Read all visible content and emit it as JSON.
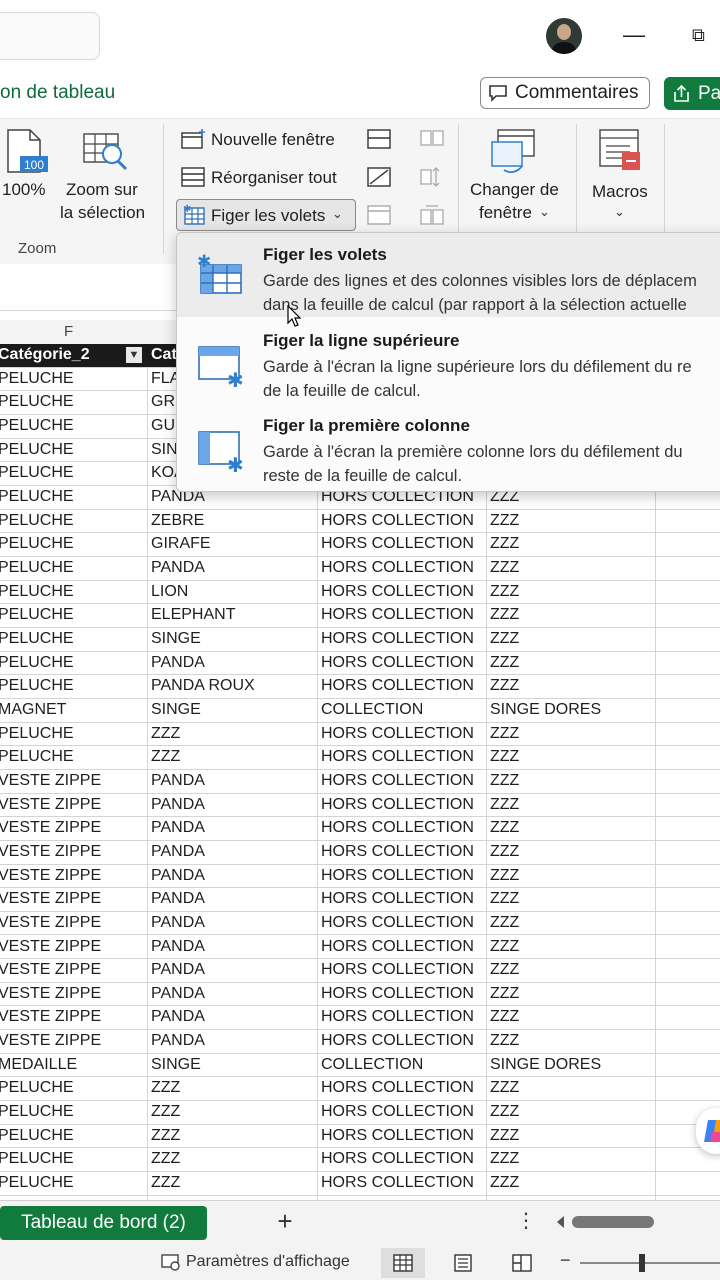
{
  "titlebar": {
    "minimize_glyph": "—",
    "restore_glyph": "⧉"
  },
  "tabbar": {
    "active_tab_partial": "on de tableau",
    "comments_label": "Commentaires",
    "share_label_partial": "Par"
  },
  "ribbon": {
    "zoom100_label": "100%",
    "zoom_selection_label_line1": "Zoom sur",
    "zoom_selection_label_line2": "la sélection",
    "zoom_group_label": "Zoom",
    "new_window_label": "Nouvelle fenêtre",
    "arrange_all_label": "Réorganiser tout",
    "freeze_panes_label": "Figer les volets",
    "switch_window_line1": "Changer de",
    "switch_window_line2": "fenêtre",
    "macros_label": "Macros",
    "zoom_icon_text": "100"
  },
  "dropdown": {
    "items": [
      {
        "title": "Figer les volets",
        "desc_line1": "Garde des lignes et des colonnes visibles lors de déplacem",
        "desc_line2": "dans la feuille de calcul (par rapport à la sélection actuelle"
      },
      {
        "title": "Figer la ligne supérieure",
        "desc_line1": "Garde à l'écran la ligne supérieure lors du défilement du re",
        "desc_line2": "de la feuille de calcul."
      },
      {
        "title": "Figer la première colonne",
        "desc_line1": "Garde à l'écran la première colonne lors du défilement du",
        "desc_line2": "reste de la feuille de calcul."
      }
    ]
  },
  "sheet": {
    "column_letter": "F",
    "header": [
      "Catégorie_2",
      "Cat"
    ],
    "rows": [
      [
        "PELUCHE",
        "FLA",
        "",
        ""
      ],
      [
        "PELUCHE",
        "GRI",
        "",
        ""
      ],
      [
        "PELUCHE",
        "GU",
        "",
        ""
      ],
      [
        "PELUCHE",
        "SIN",
        "",
        ""
      ],
      [
        "PELUCHE",
        "KOA",
        "",
        ""
      ],
      [
        "PELUCHE",
        "PANDA",
        "HORS COLLECTION",
        "ZZZ"
      ],
      [
        "PELUCHE",
        "ZEBRE",
        "HORS COLLECTION",
        "ZZZ"
      ],
      [
        "PELUCHE",
        "GIRAFE",
        "HORS COLLECTION",
        "ZZZ"
      ],
      [
        "PELUCHE",
        "PANDA",
        "HORS COLLECTION",
        "ZZZ"
      ],
      [
        "PELUCHE",
        "LION",
        "HORS COLLECTION",
        "ZZZ"
      ],
      [
        "PELUCHE",
        "ELEPHANT",
        "HORS COLLECTION",
        "ZZZ"
      ],
      [
        "PELUCHE",
        "SINGE",
        "HORS COLLECTION",
        "ZZZ"
      ],
      [
        "PELUCHE",
        "PANDA",
        "HORS COLLECTION",
        "ZZZ"
      ],
      [
        "PELUCHE",
        "PANDA ROUX",
        "HORS COLLECTION",
        "ZZZ"
      ],
      [
        "MAGNET",
        "SINGE",
        "COLLECTION",
        "SINGE DORES"
      ],
      [
        "PELUCHE",
        "ZZZ",
        "HORS COLLECTION",
        "ZZZ"
      ],
      [
        "PELUCHE",
        "ZZZ",
        "HORS COLLECTION",
        "ZZZ"
      ],
      [
        "VESTE ZIPPE",
        "PANDA",
        "HORS COLLECTION",
        "ZZZ"
      ],
      [
        "VESTE ZIPPE",
        "PANDA",
        "HORS COLLECTION",
        "ZZZ"
      ],
      [
        "VESTE ZIPPE",
        "PANDA",
        "HORS COLLECTION",
        "ZZZ"
      ],
      [
        "VESTE ZIPPE",
        "PANDA",
        "HORS COLLECTION",
        "ZZZ"
      ],
      [
        "VESTE ZIPPE",
        "PANDA",
        "HORS COLLECTION",
        "ZZZ"
      ],
      [
        "VESTE ZIPPE",
        "PANDA",
        "HORS COLLECTION",
        "ZZZ"
      ],
      [
        "VESTE ZIPPE",
        "PANDA",
        "HORS COLLECTION",
        "ZZZ"
      ],
      [
        "VESTE ZIPPE",
        "PANDA",
        "HORS COLLECTION",
        "ZZZ"
      ],
      [
        "VESTE ZIPPE",
        "PANDA",
        "HORS COLLECTION",
        "ZZZ"
      ],
      [
        "VESTE ZIPPE",
        "PANDA",
        "HORS COLLECTION",
        "ZZZ"
      ],
      [
        "VESTE ZIPPE",
        "PANDA",
        "HORS COLLECTION",
        "ZZZ"
      ],
      [
        "VESTE ZIPPE",
        "PANDA",
        "HORS COLLECTION",
        "ZZZ"
      ],
      [
        "MEDAILLE",
        "SINGE",
        "COLLECTION",
        "SINGE DORES"
      ],
      [
        "PELUCHE",
        "ZZZ",
        "HORS COLLECTION",
        "ZZZ"
      ],
      [
        "PELUCHE",
        "ZZZ",
        "HORS COLLECTION",
        "ZZZ"
      ],
      [
        "PELUCHE",
        "ZZZ",
        "HORS COLLECTION",
        "ZZZ"
      ],
      [
        "PELUCHE",
        "ZZZ",
        "HORS COLLECTION",
        "ZZZ"
      ],
      [
        "PELUCHE",
        "ZZZ",
        "HORS COLLECTION",
        "ZZZ"
      ]
    ]
  },
  "sheetbar": {
    "active_sheet": "Tableau de bord (2)",
    "add_sheet_glyph": "+",
    "more_glyph": "⋮"
  },
  "statusbar": {
    "display_settings_label": "Paramètres d'affichage",
    "zoom_minus": "−"
  },
  "colors": {
    "accent_green": "#117a3d",
    "header_black": "#1a1a1a"
  }
}
